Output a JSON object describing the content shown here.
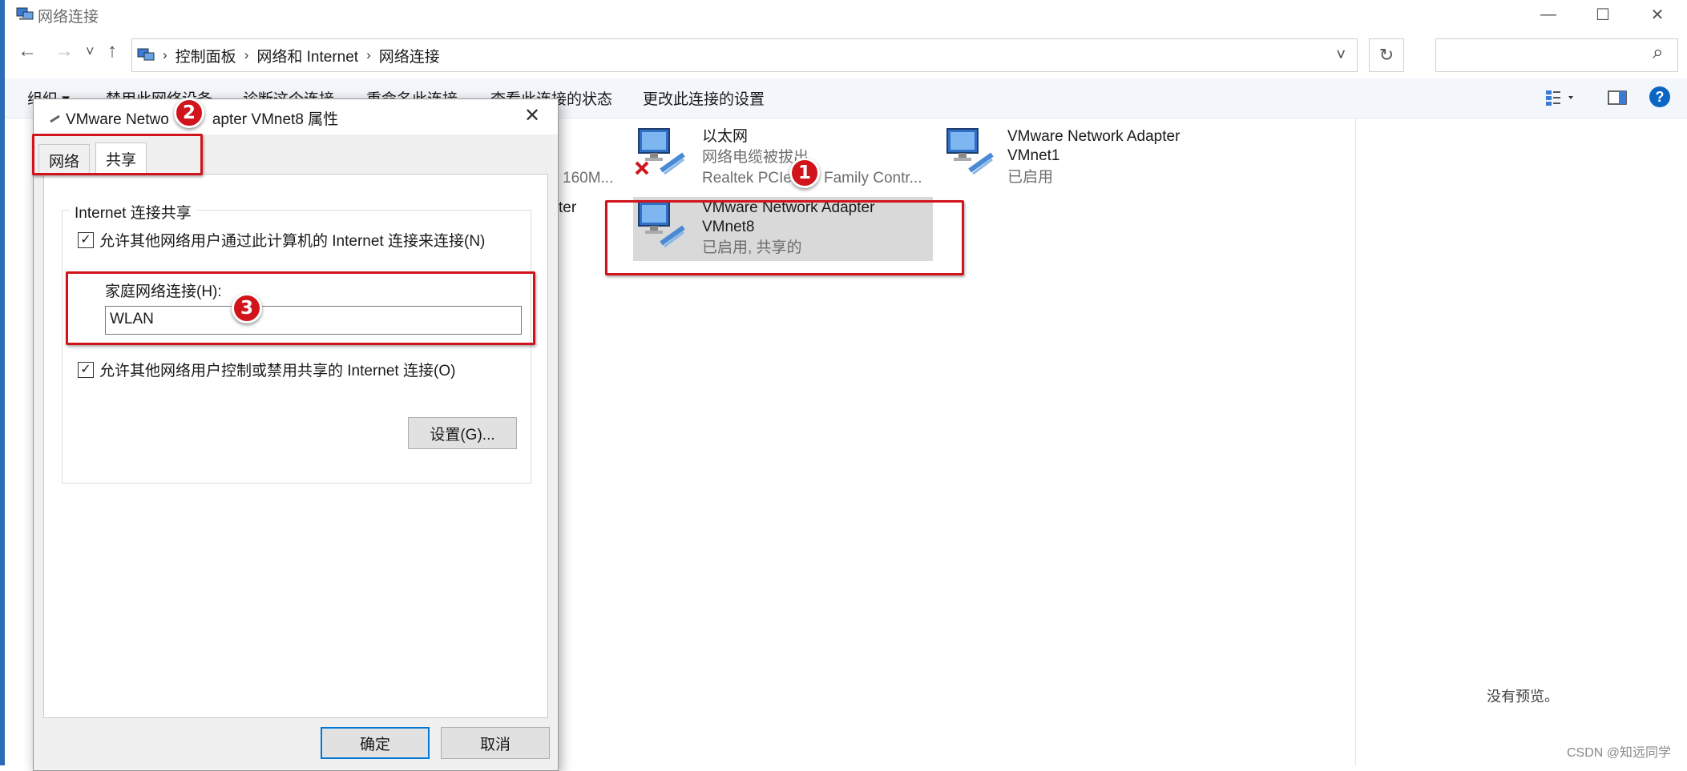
{
  "window": {
    "title": "网络连接",
    "minimize_glyph": "—",
    "maximize_glyph": "☐",
    "close_glyph": "✕"
  },
  "nav": {
    "back": "←",
    "forward": "→",
    "history": "˅",
    "up": "↑",
    "breadcrumbs": [
      "控制面板",
      "网络和 Internet",
      "网络连接"
    ],
    "dropdown": "˅",
    "refresh": "↻",
    "search_placeholder": "",
    "search_icon": "⌕"
  },
  "commands": {
    "organize": "组织 ▾",
    "disable": "禁用此网络设备",
    "diagnose": "诊断这个连接",
    "rename": "重命名此连接",
    "view_status": "查看此连接的状态",
    "change_settings": "更改此连接的设置",
    "help": "?"
  },
  "connections": {
    "partial_speed": "160M...",
    "partial_name": "ter",
    "ethernet": {
      "name": "以太网",
      "status": "网络电缆被拔出",
      "device": "Realtek PCIe",
      "device_tail": "Family Contr..."
    },
    "vmnet1": {
      "name_line1": "VMware Network Adapter",
      "name_line2": "VMnet1",
      "status": "已启用"
    },
    "vmnet8": {
      "name_line1": "VMware Network Adapter",
      "name_line2": "VMnet8",
      "status": "已启用, 共享的"
    }
  },
  "dialog": {
    "title_part1": "VMware Netwo",
    "title_part2": "apter VMnet8 属性",
    "close": "✕",
    "tabs": [
      "网络",
      "共享"
    ],
    "group_title": "Internet 连接共享",
    "allow_share": "允许其他网络用户通过此计算机的 Internet 连接来连接(N)",
    "home_label": "家庭网络连接(H):",
    "home_value": "WLAN",
    "allow_control": "允许其他网络用户控制或禁用共享的 Internet 连接(O)",
    "settings_btn": "设置(G)...",
    "ok_btn": "确定",
    "cancel_btn": "取消",
    "check_glyph": "✓"
  },
  "annotations": {
    "badge1": "1",
    "badge2": "2",
    "badge3": "3"
  },
  "preview": {
    "empty": "没有预览。"
  },
  "watermark": "CSDN @知远同学",
  "colors": {
    "accent": "#0078d7",
    "annotation_red": "#d1141b",
    "selection": "#d9d9d9",
    "command_bar": "#f3f6fb"
  }
}
